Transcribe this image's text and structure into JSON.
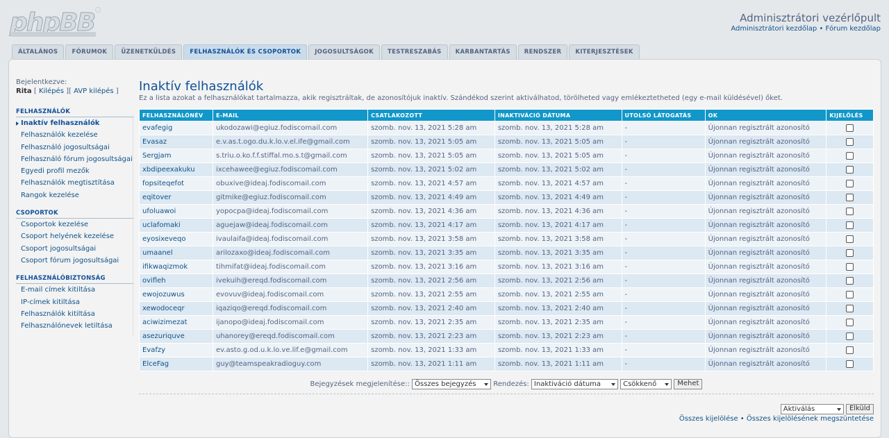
{
  "header": {
    "title": "Adminisztrátori vezérlőpult",
    "link_acp_home": "Adminisztrátori kezdőlap",
    "separator": " • ",
    "link_forum_home": "Fórum kezdőlap"
  },
  "tabs": [
    "ÁLTALÁNOS",
    "FÓRUMOK",
    "ÜZENETKÜLDÉS",
    "FELHASZNÁLÓK ÉS CSOPORTOK",
    "JOGOSULTSÁGOK",
    "TESTRESZABÁS",
    "KARBANTARTÁS",
    "RENDSZER",
    "KITERJESZTÉSEK"
  ],
  "sidebar": {
    "login_label": "Bejelentkezve:",
    "user": "Rita",
    "logout": "Kilépés",
    "acp_logout": "AVP kilépés",
    "sections": [
      {
        "heading": "FELHASZNÁLÓK",
        "items": [
          "Inaktív felhasználók",
          "Felhasználók kezelése",
          "Felhasználó jogosultságai",
          "Felhasználó fórum jogosultságai",
          "Egyedi profil mezők",
          "Felhasználók megtisztítása",
          "Rangok kezelése"
        ]
      },
      {
        "heading": "CSOPORTOK",
        "items": [
          "Csoportok kezelése",
          "Csoport helyének kezelése",
          "Csoport jogosultságai",
          "Csoport fórum jogosultságai"
        ]
      },
      {
        "heading": "FELHASZNÁLÓBIZTONSÁG",
        "items": [
          "E-mail címek kitiltása",
          "IP-címek kitiltása",
          "Felhasználók kitiltása",
          "Felhasználónevek letiltása"
        ]
      }
    ]
  },
  "main": {
    "title": "Inaktív felhasználók",
    "description": "Ez a lista azokat a felhasználókat tartalmazza, akik regisztráltak, de azonosítójuk inaktív. Szándékod szerint aktiválhatod, törölheted vagy emlékeztetheted (egy e-mail küldésével) őket.",
    "columns": [
      "FELHASZNÁLÓNÉV",
      "E-MAIL",
      "CSATLAKOZOTT",
      "INAKTIVÁCIÓ DÁTUMA",
      "UTOLSÓ LÁTOGATÁS",
      "OK",
      "KIJELÖLÉS"
    ],
    "rows": [
      [
        "evafegig",
        "ukodozawi@egiuz.fodiscomail.com",
        "szomb. nov. 13, 2021 5:28 am",
        "szomb. nov. 13, 2021 5:28 am",
        "-",
        "Újonnan regisztrált azonosító"
      ],
      [
        "Evasaz",
        "e.v.as.t.ogo.du.k.lo.v.el.ife@gmail.com",
        "szomb. nov. 13, 2021 5:05 am",
        "szomb. nov. 13, 2021 5:05 am",
        "-",
        "Újonnan regisztrált azonosító"
      ],
      [
        "Sergjam",
        "s.triu.o.ko.f.f.stiffal.mo.s.t@gmail.com",
        "szomb. nov. 13, 2021 5:05 am",
        "szomb. nov. 13, 2021 5:05 am",
        "-",
        "Újonnan regisztrált azonosító"
      ],
      [
        "xbdipeexakuku",
        "ixcehawee@egiuz.fodiscomail.com",
        "szomb. nov. 13, 2021 5:02 am",
        "szomb. nov. 13, 2021 5:02 am",
        "-",
        "Újonnan regisztrált azonosító"
      ],
      [
        "fopsiteqefot",
        "obuxive@ideaj.fodiscomail.com",
        "szomb. nov. 13, 2021 4:57 am",
        "szomb. nov. 13, 2021 4:57 am",
        "-",
        "Újonnan regisztrált azonosító"
      ],
      [
        "eqitover",
        "gitmike@egiuz.fodiscomail.com",
        "szomb. nov. 13, 2021 4:49 am",
        "szomb. nov. 13, 2021 4:49 am",
        "-",
        "Újonnan regisztrált azonosító"
      ],
      [
        "ufoluawoi",
        "yopocpa@ideaj.fodiscomail.com",
        "szomb. nov. 13, 2021 4:36 am",
        "szomb. nov. 13, 2021 4:36 am",
        "-",
        "Újonnan regisztrált azonosító"
      ],
      [
        "uclafomaki",
        "aguejaw@ideaj.fodiscomail.com",
        "szomb. nov. 13, 2021 4:17 am",
        "szomb. nov. 13, 2021 4:17 am",
        "-",
        "Újonnan regisztrált azonosító"
      ],
      [
        "eyosixeveqo",
        "ivaulaifa@ideaj.fodiscomail.com",
        "szomb. nov. 13, 2021 3:58 am",
        "szomb. nov. 13, 2021 3:58 am",
        "-",
        "Újonnan regisztrált azonosító"
      ],
      [
        "umaanel",
        "arilozaxo@ideaj.fodiscomail.com",
        "szomb. nov. 13, 2021 3:35 am",
        "szomb. nov. 13, 2021 3:35 am",
        "-",
        "Újonnan regisztrált azonosító"
      ],
      [
        "ifikwaqizmok",
        "tihmifat@ideaj.fodiscomail.com",
        "szomb. nov. 13, 2021 3:16 am",
        "szomb. nov. 13, 2021 3:16 am",
        "-",
        "Újonnan regisztrált azonosító"
      ],
      [
        "ovifleh",
        "ivekuih@ereqd.fodiscomail.com",
        "szomb. nov. 13, 2021 2:56 am",
        "szomb. nov. 13, 2021 2:56 am",
        "-",
        "Újonnan regisztrált azonosító"
      ],
      [
        "ewojozuwus",
        "evovuv@ideaj.fodiscomail.com",
        "szomb. nov. 13, 2021 2:55 am",
        "szomb. nov. 13, 2021 2:55 am",
        "-",
        "Újonnan regisztrált azonosító"
      ],
      [
        "xewodoceqr",
        "iqaziqo@ereqd.fodiscomail.com",
        "szomb. nov. 13, 2021 2:40 am",
        "szomb. nov. 13, 2021 2:40 am",
        "-",
        "Újonnan regisztrált azonosító"
      ],
      [
        "aciwizimezat",
        "ijanopo@ideaj.fodiscomail.com",
        "szomb. nov. 13, 2021 2:35 am",
        "szomb. nov. 13, 2021 2:35 am",
        "-",
        "Újonnan regisztrált azonosító"
      ],
      [
        "asezuriquve",
        "uhanorey@ereqd.fodiscomail.com",
        "szomb. nov. 13, 2021 2:23 am",
        "szomb. nov. 13, 2021 2:23 am",
        "-",
        "Újonnan regisztrált azonosító"
      ],
      [
        "Evafzy",
        "ev.asto.g.od.u.k.lo.ve.lif.e@gmail.com",
        "szomb. nov. 13, 2021 1:33 am",
        "szomb. nov. 13, 2021 1:33 am",
        "-",
        "Újonnan regisztrált azonosító"
      ],
      [
        "ElceFag",
        "guy@teamspeakradioguy.com",
        "szomb. nov. 13, 2021 1:11 am",
        "szomb. nov. 13, 2021 1:11 am",
        "-",
        "Újonnan regisztrált azonosító"
      ]
    ]
  },
  "filter": {
    "show_label": "Bejegyzések megjelenítése::",
    "show_value": "Összes bejegyzés",
    "sort_label": "Rendezés:",
    "sort_value": "Inaktiváció dátuma",
    "order_value": "Csökkenő",
    "go_button": "Mehet"
  },
  "actions": {
    "action_value": "Aktiválás",
    "submit_button": "Elküld",
    "select_all": "Összes kijelölése",
    "separator": " • ",
    "unselect_all": "Összes kijelölésének megszüntetése"
  },
  "colors": {
    "table_header": "#1197c9",
    "link": "#105289",
    "row_light": "#eef3f7",
    "row_dark": "#dce8f2"
  }
}
